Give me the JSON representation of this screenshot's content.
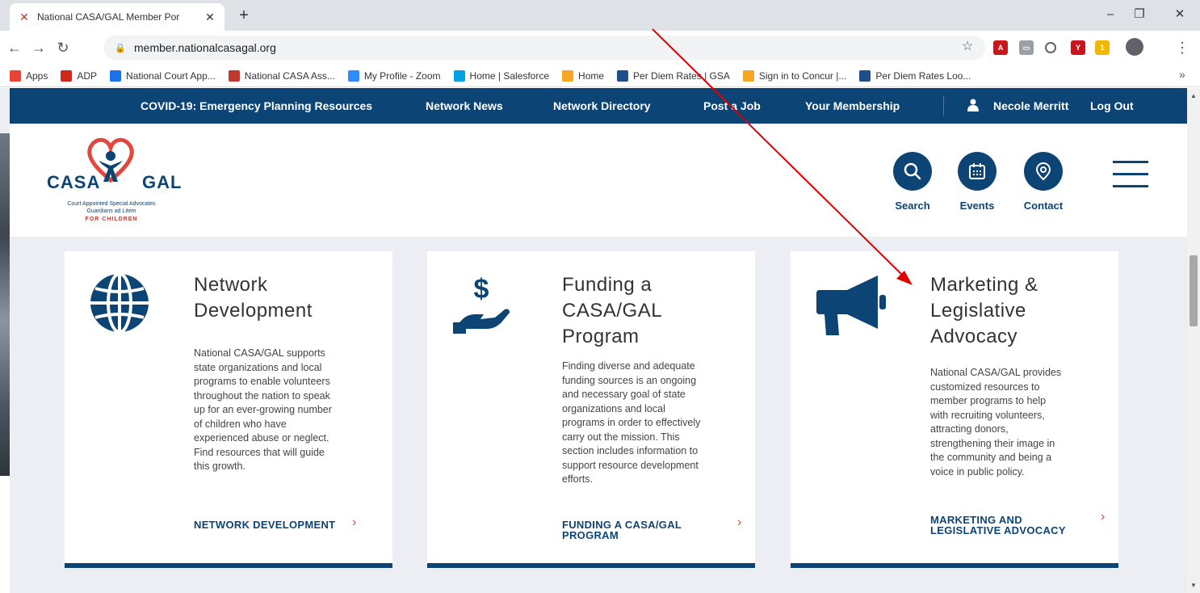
{
  "browser": {
    "tab_title": "National CASA/GAL Member Por",
    "new_tab": "+",
    "url": "member.nationalcasagal.org",
    "bookmarks": [
      {
        "label": "Apps",
        "icon": "apps-grid-icon",
        "color": "#ea4335"
      },
      {
        "label": "ADP",
        "icon": "adp-icon",
        "color": "#d0271d"
      },
      {
        "label": "National Court App...",
        "icon": "globe-icon",
        "color": "#1a73e8"
      },
      {
        "label": "National CASA Ass...",
        "icon": "casa-icon",
        "color": "#c0392b"
      },
      {
        "label": "My Profile - Zoom",
        "icon": "zoom-icon",
        "color": "#2d8cff"
      },
      {
        "label": "Home | Salesforce",
        "icon": "salesforce-icon",
        "color": "#00a1e0"
      },
      {
        "label": "Home",
        "icon": "concur-icon",
        "color": "#f5a623"
      },
      {
        "label": "Per Diem Rates | GSA",
        "icon": "gsa-icon",
        "color": "#1f4e8c"
      },
      {
        "label": "Sign in to Concur |...",
        "icon": "concur-icon",
        "color": "#f5a623"
      },
      {
        "label": "Per Diem Rates Loo...",
        "icon": "gsa-icon",
        "color": "#1f4e8c"
      }
    ],
    "bookmarks_more": "»"
  },
  "site": {
    "nav": {
      "covid": "COVID-19: Emergency Planning Resources",
      "news": "Network News",
      "directory": "Network Directory",
      "post_job": "Post a Job",
      "membership": "Your Membership",
      "user": "Necole Merritt",
      "logout": "Log Out"
    },
    "logo": {
      "casa": "CASA",
      "gal": "GAL",
      "line1": "Court Appointed Special Advocates",
      "line2": "Guardians ad Litem",
      "line3": "FOR CHILDREN"
    },
    "header_buttons": [
      {
        "label": "Search",
        "icon": "search-icon"
      },
      {
        "label": "Events",
        "icon": "calendar-icon"
      },
      {
        "label": "Contact",
        "icon": "map-pin-icon"
      }
    ],
    "cards": [
      {
        "title_lines": [
          "Network",
          "Development"
        ],
        "icon": "globe-icon",
        "desc_lines": [
          "National CASA/GAL supports",
          "state organizations and local",
          "programs to enable volunteers",
          "throughout the nation to speak",
          "up for an ever-growing number",
          "of children who have",
          "experienced abuse or neglect.",
          "Find resources that will guide",
          "this growth."
        ],
        "link_lines": [
          "NETWORK DEVELOPMENT"
        ]
      },
      {
        "title_lines": [
          "Funding a",
          "CASA/GAL",
          "Program"
        ],
        "icon": "dollar-hand-icon",
        "desc_lines": [
          "Finding diverse and adequate",
          "funding sources is an ongoing",
          "and necessary goal of state",
          "organizations and local",
          "programs in order to effectively",
          "carry out the mission. This",
          "section includes information to",
          "support resource development",
          "efforts."
        ],
        "link_lines": [
          "FUNDING A CASA/GAL",
          "PROGRAM"
        ]
      },
      {
        "title_lines": [
          "Marketing &",
          "Legislative",
          "Advocacy"
        ],
        "icon": "megaphone-icon",
        "desc_lines": [
          "National CASA/GAL provides",
          "customized resources to",
          "member programs to help",
          "with recruiting volunteers,",
          "attracting donors,",
          "strengthening their image in",
          "the community and being a",
          "voice in public policy."
        ],
        "link_lines": [
          "MARKETING AND",
          "LEGISLATIVE ADVOCACY"
        ]
      }
    ],
    "chevron": "›"
  },
  "colors": {
    "brand_navy": "#0d4476",
    "accent_red": "#e2483d",
    "annotation_red": "#e00000"
  }
}
